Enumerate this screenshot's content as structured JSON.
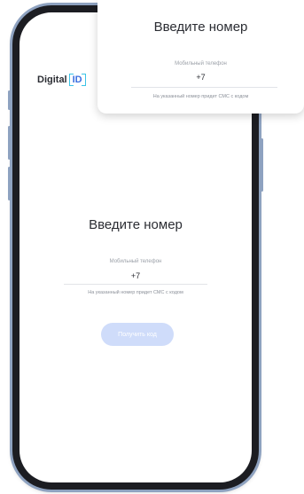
{
  "brand": {
    "logo_text": "Digital",
    "logo_badge": "ID",
    "accent": "#3b6fe0",
    "bracket_color": "#3bc4e6"
  },
  "screen": {
    "title": "Введите номер",
    "phone_label": "Мобильный телефон",
    "phone_value": "+7",
    "hint": "На указанный номер придет СМС с кодом",
    "button_label": "Получить код",
    "button_color": "#cfdcfa"
  },
  "zoom_card": {
    "title": "Введите номер",
    "phone_label": "Мобильный телефон",
    "phone_value": "+7",
    "hint": "На указанный номер придет СМС с кодом"
  }
}
